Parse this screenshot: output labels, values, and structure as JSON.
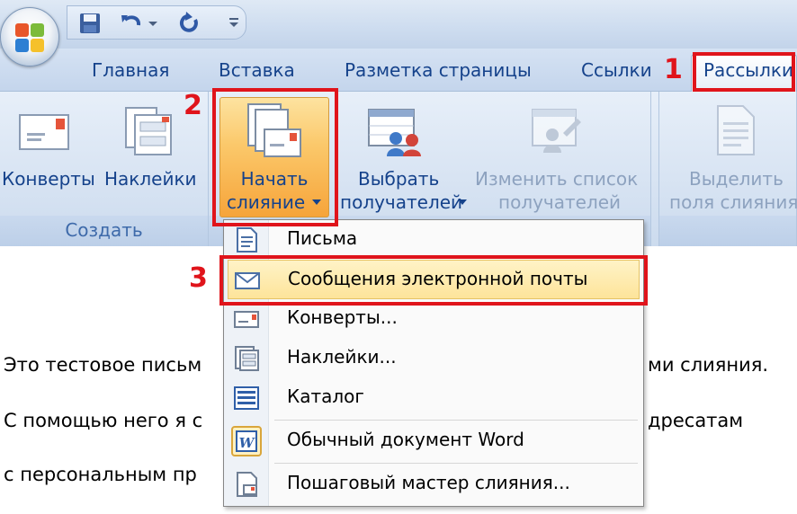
{
  "tabs": {
    "home": "Главная",
    "insert": "Вставка",
    "page_layout": "Разметка страницы",
    "references": "Ссылки",
    "mailings": "Рассылки"
  },
  "ribbon": {
    "create_group": {
      "label": "Создать",
      "envelopes": "Конверты",
      "labels": "Наклейки"
    },
    "start_merge": {
      "line1": "Начать",
      "line2": "слияние"
    },
    "select_recipients": {
      "line1": "Выбрать",
      "line2": "получателей"
    },
    "edit_list": {
      "line1": "Изменить список",
      "line2": "получателей"
    },
    "highlight_fields": {
      "line1": "Выделить",
      "line2": "поля слияния"
    }
  },
  "menu": {
    "items": [
      {
        "label": "Письма",
        "icon": "letter-icon"
      },
      {
        "label": "Сообщения электронной почты",
        "icon": "email-icon"
      },
      {
        "label": "Конверты...",
        "icon": "envelope-icon"
      },
      {
        "label": "Наклейки...",
        "icon": "labels-icon"
      },
      {
        "label": "Каталог",
        "icon": "directory-icon"
      },
      {
        "label": "Обычный документ Word",
        "icon": "word-document-icon"
      },
      {
        "label": "Пошаговый мастер слияния...",
        "icon": "wizard-icon"
      }
    ]
  },
  "document": {
    "line1_left": "Это тестовое письм",
    "line1_right": "ми слияния.",
    "line2_left": "С помощью него я с",
    "line2_right": "дресатам",
    "line3_left": "с персональным пр"
  },
  "annotations": {
    "step1": "1",
    "step2": "2",
    "step3": "3"
  },
  "colors": {
    "annotation_red": "#e0141b",
    "highlight_orange": "#f6a43a",
    "ribbon_text": "#15428b"
  }
}
